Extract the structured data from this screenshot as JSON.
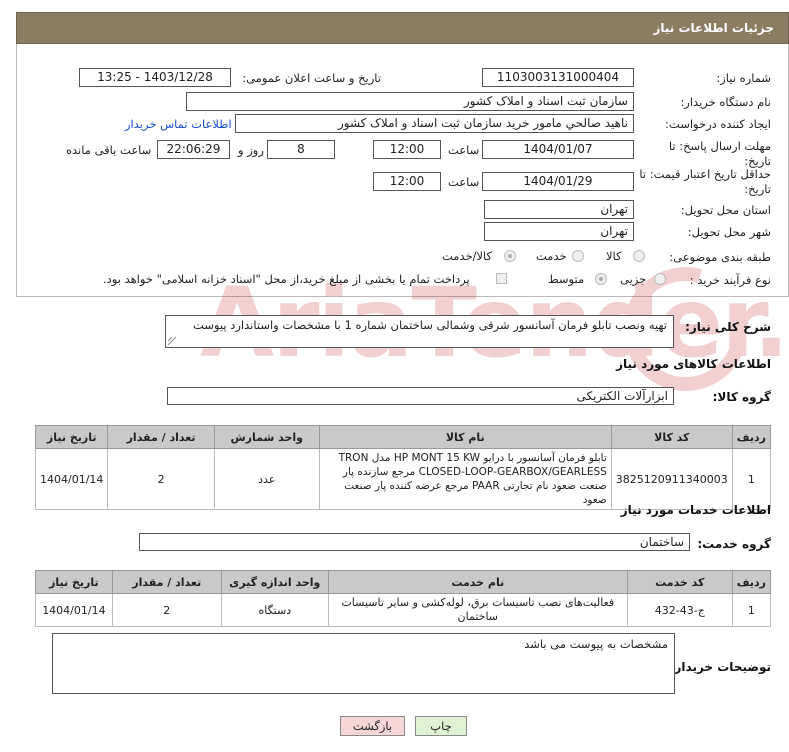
{
  "header": {
    "title": "جزئیات اطلاعات نیاز"
  },
  "fields": {
    "need_number_label": "شماره نیاز:",
    "need_number": "1103003131000404",
    "announce_label": "تاریخ و ساعت اعلان عمومی:",
    "announce_value": "1403/12/28 - 13:25",
    "buyer_org_label": "نام دستگاه خریدار:",
    "buyer_org": "سازمان ثبت اسناد و املاک کشور",
    "creator_label": "ایجاد کننده درخواست:",
    "creator": "ناهید صالحي مامور خرید سازمان ثبت اسناد و املاک کشور",
    "contact_link": "اطلاعات تماس خریدار",
    "deadline_label": "مهلت ارسال پاسخ: تا تاریخ:",
    "deadline_date": "1404/01/07",
    "time_label": "ساعت",
    "deadline_time": "12:00",
    "days_value": "8",
    "days_label": "روز و",
    "remaining_time": "22:06:29",
    "remaining_label": "ساعت باقی مانده",
    "validity_label": "حداقل تاریخ اعتبار قیمت: تا تاریخ:",
    "validity_date": "1404/01/29",
    "validity_time": "12:00",
    "province_label": "استان محل تحویل:",
    "province": "تهران",
    "city_label": "شهر محل تحویل:",
    "city": "تهران",
    "category_label": "طبقه بندی موضوعی:",
    "category_options": [
      "کالا",
      "خدمت",
      "کالا/خدمت"
    ],
    "process_label": "نوع فرآیند خرید :",
    "process_options": [
      "جزیی",
      "متوسط"
    ],
    "payment_note": "پرداخت تمام یا بخشی از مبلغ خرید،از محل \"اسناد خزانه اسلامی\" خواهد بود."
  },
  "summary": {
    "label": "شرح کلی نیاز:",
    "text": "تهیه ونصب تابلو فرمان آسانسور شرقی وشمالی ساختمان شماره 1 با مشخصات واستاندارد پیوست"
  },
  "goods": {
    "section_title": "اطلاعات کالاهای مورد نیاز",
    "group_label": "گروه کالا:",
    "group_value": "ابزارآلات الکتریکی",
    "columns": [
      "ردیف",
      "کد کالا",
      "نام کالا",
      "واحد شمارش",
      "تعداد / مقدار",
      "تاریخ نیاز"
    ],
    "rows": [
      {
        "row": "1",
        "code": "3825120911340003",
        "name": "تابلو فرمان آسانسور با درایو HP MONT 15 KW مدل TRON CLOSED-LOOP-GEARBOX/GEARLESS مرجع سازنده پار صنعت صعود نام تجارتی PAAR مرجع عرضه کننده پار صنعت صعود",
        "unit": "عدد",
        "qty": "2",
        "date": "1404/01/14"
      }
    ]
  },
  "services": {
    "section_title": "اطلاعات خدمات مورد نیاز",
    "group_label": "گروه خدمت:",
    "group_value": "ساختمان",
    "columns": [
      "ردیف",
      "کد خدمت",
      "نام خدمت",
      "واحد اندازه گیری",
      "تعداد / مقدار",
      "تاریخ نیاز"
    ],
    "rows": [
      {
        "row": "1",
        "code": "ج-43-432",
        "name": "فعالیت‌های نصب تاسیسات برق، لوله‌کشی و سایر تاسیسات ساختمان",
        "unit": "دستگاه",
        "qty": "2",
        "date": "1404/01/14"
      }
    ]
  },
  "buyer_notes": {
    "label": "توضیحات خریدار:",
    "text": "مشخصات به پیوست می باشد"
  },
  "buttons": {
    "print": "چاپ",
    "back": "بازگشت"
  },
  "colors": {
    "header_bg": "#8b7d62",
    "table_header_bg": "#c9c9c9",
    "back_button_bg": "#f7d6d6",
    "print_button_bg": "#dff3d3",
    "link": "#1a4fd6"
  }
}
